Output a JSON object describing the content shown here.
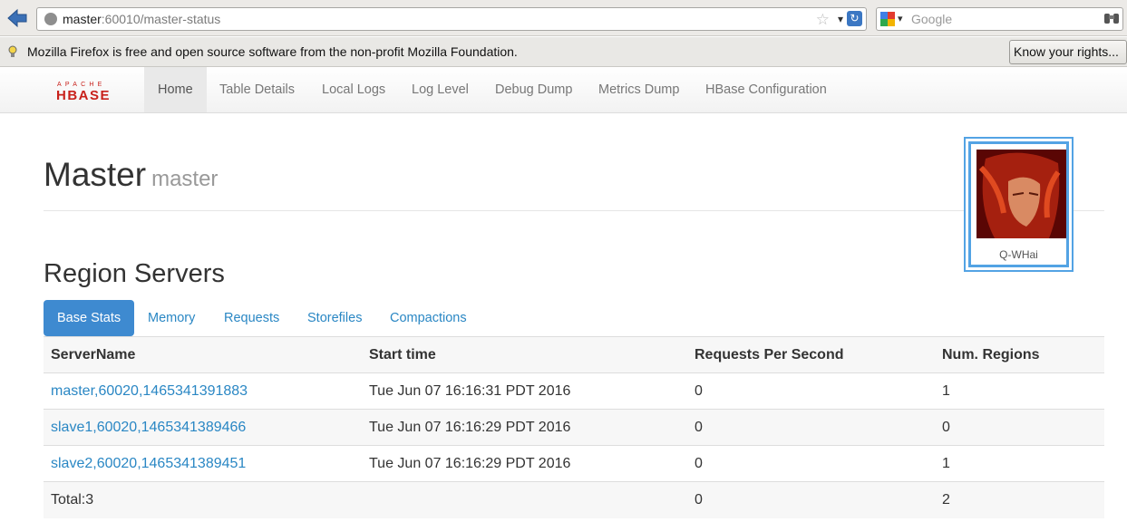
{
  "browser": {
    "url_host": "master",
    "url_rest": ":60010/master-status",
    "search_placeholder": "Google",
    "notification": "Mozilla Firefox is free and open source software from the non-profit Mozilla Foundation.",
    "rights_button": "Know your rights..."
  },
  "nav": {
    "logo_top": "APACHE",
    "logo_main": "HBASE",
    "items": [
      {
        "label": "Home",
        "active": true
      },
      {
        "label": "Table Details"
      },
      {
        "label": "Local Logs"
      },
      {
        "label": "Log Level"
      },
      {
        "label": "Debug Dump"
      },
      {
        "label": "Metrics Dump"
      },
      {
        "label": "HBase Configuration"
      }
    ]
  },
  "page": {
    "title": "Master",
    "subtitle": "master",
    "section_title": "Region Servers"
  },
  "avatar": {
    "name": "Q-WHai"
  },
  "tabs": [
    {
      "label": "Base Stats",
      "active": true
    },
    {
      "label": "Memory"
    },
    {
      "label": "Requests"
    },
    {
      "label": "Storefiles"
    },
    {
      "label": "Compactions"
    }
  ],
  "table": {
    "headers": [
      "ServerName",
      "Start time",
      "Requests Per Second",
      "Num. Regions"
    ],
    "rows": [
      {
        "server": "master,60020,1465341391883",
        "start": "Tue Jun 07 16:16:31 PDT 2016",
        "rps": "0",
        "regions": "1"
      },
      {
        "server": "slave1,60020,1465341389466",
        "start": "Tue Jun 07 16:16:29 PDT 2016",
        "rps": "0",
        "regions": "0"
      },
      {
        "server": "slave2,60020,1465341389451",
        "start": "Tue Jun 07 16:16:29 PDT 2016",
        "rps": "0",
        "regions": "1"
      }
    ],
    "total": {
      "label": "Total:3",
      "rps": "0",
      "regions": "2"
    }
  },
  "colors": {
    "accent": "#3e8ad0",
    "link": "#2a87c4",
    "logo_red": "#c8211b"
  }
}
